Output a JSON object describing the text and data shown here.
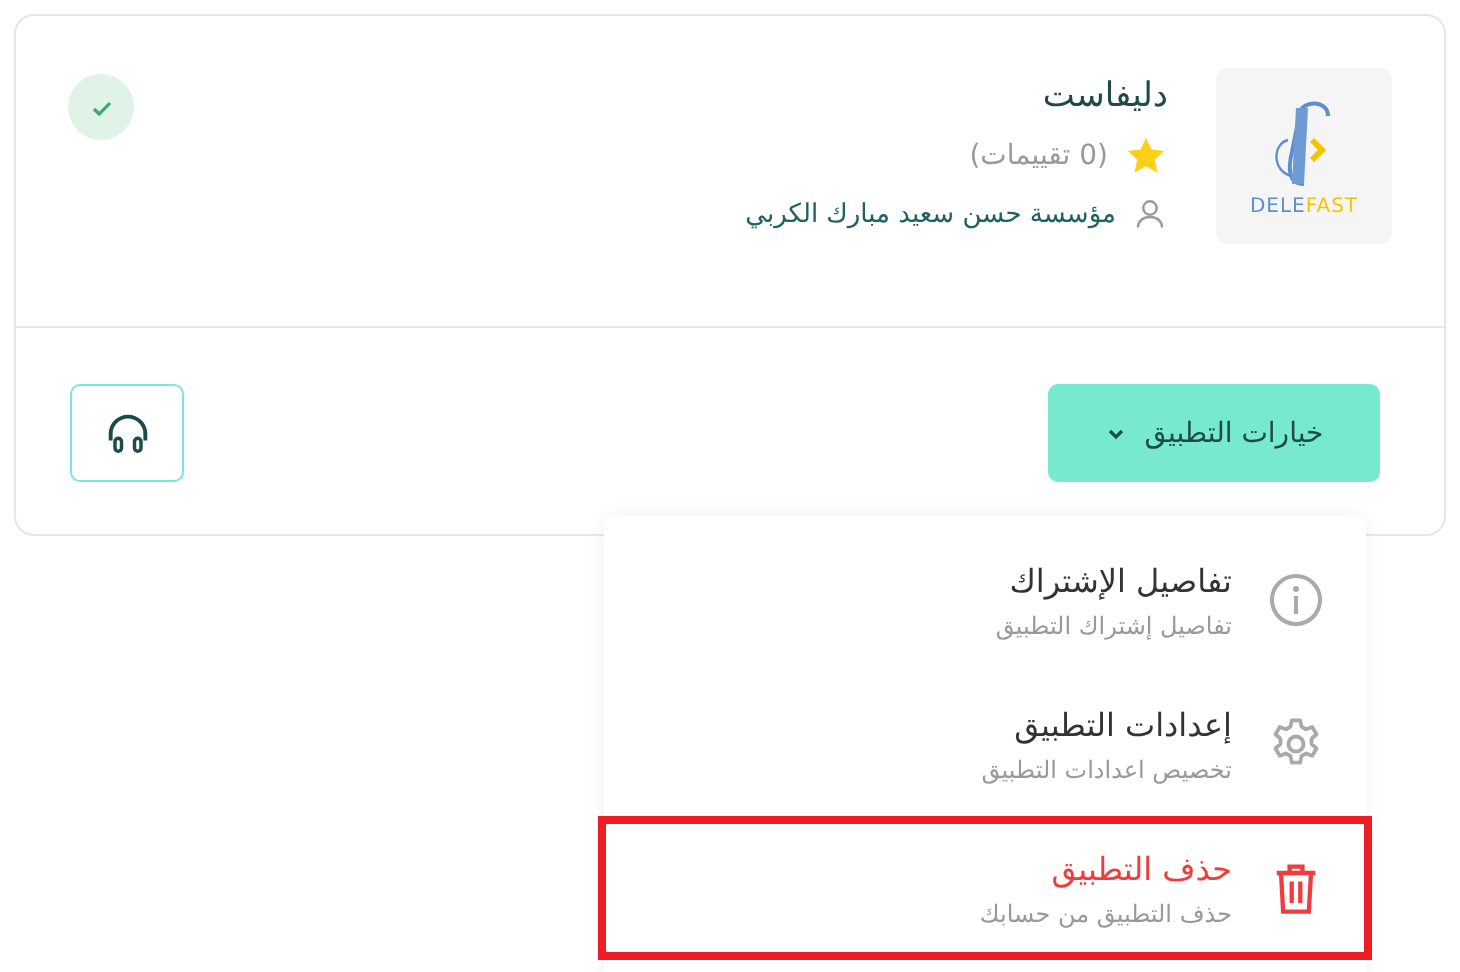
{
  "app": {
    "name": "دليفاست",
    "logo": {
      "part_1": "DELE",
      "part_2": "FAST"
    },
    "rating": "(0 تقييمات)",
    "owner": "مؤسسة حسن سعيد مبارك الكربي",
    "verified": true
  },
  "options_button": {
    "label": "خيارات التطبيق",
    "expanded": true
  },
  "menu": [
    {
      "kind": "info",
      "title": "تفاصيل الإشتراك",
      "subtitle": "تفاصيل إشتراك التطبيق",
      "highlighted": false
    },
    {
      "kind": "settings",
      "title": "إعدادات التطبيق",
      "subtitle": "تخصيص اعدادات التطبيق",
      "highlighted": false
    },
    {
      "kind": "delete",
      "title": "حذف التطبيق",
      "subtitle": "حذف التطبيق من حسابك",
      "highlighted": true
    }
  ]
}
